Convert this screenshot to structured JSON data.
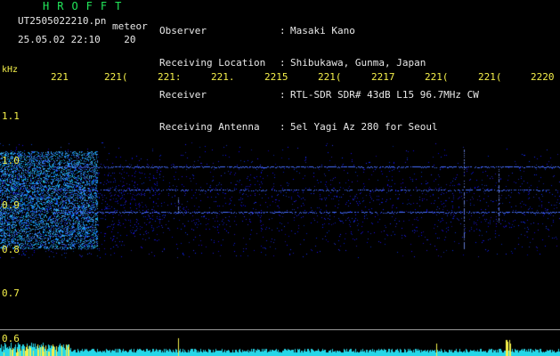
{
  "program": {
    "title": "HROFFT"
  },
  "file": {
    "name": "UT2505022210.pn",
    "suffix": "meteor"
  },
  "timestamp": {
    "date_time": "25.05.02 22:10",
    "minute": "20"
  },
  "info": {
    "labels": [
      "Observer",
      "Receiving Location",
      "Receiver",
      "Receiving Antenna"
    ],
    "colon": ":",
    "values": [
      "Masaki Kano",
      "Shibukawa, Gunma, Japan",
      "RTL-SDR SDR# 43dB L15 96.7MHz CW",
      "5el Yagi Az 280 for Seoul"
    ]
  },
  "axis": {
    "y_unit": "kHz",
    "time_ticks": [
      "221",
      "221(",
      "221:",
      "221.",
      "2215",
      "221(",
      "2217",
      "221(",
      "221(",
      "2220"
    ],
    "freq_ticks": [
      "1.1",
      "1.0",
      "0.9",
      "0.8",
      "0.7",
      "0.6"
    ]
  },
  "colors": {
    "background": "#000000",
    "text_yellow": "#f5f04a",
    "title_green": "#22e85a",
    "signal_blue": "#2a4dff",
    "level_cyan": "#26d7e8"
  }
}
